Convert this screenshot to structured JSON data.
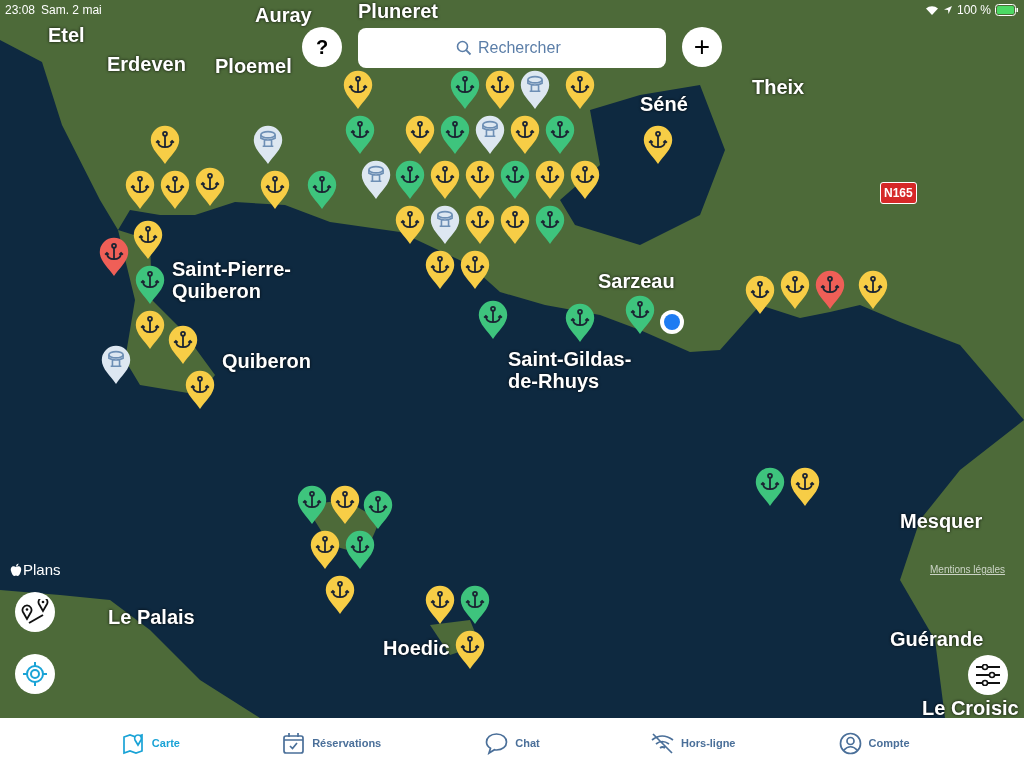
{
  "status_bar": {
    "time": "23:08",
    "date": "Sam. 2 mai",
    "battery": "100 %"
  },
  "top_bar": {
    "help_button": "?",
    "search": {
      "placeholder": "Rechercher"
    },
    "add_button": "+"
  },
  "map": {
    "labels": [
      "Pluneret",
      "Auray",
      "Etel",
      "Erdeven",
      "Ploemel",
      "Theix",
      "Séné",
      "Sarzeau",
      "Saint-Gildas-de-Rhuys",
      "Saint-Pierre-Quiberon",
      "Quiberon",
      "Le Palais",
      "Hoedic",
      "Mesquer",
      "Guérande",
      "Le Croisic"
    ],
    "road_sign": "N165",
    "pins": [
      {
        "kind": "buoy",
        "color": "#dde7f1"
      },
      {
        "kind": "buoy",
        "color": "#dde7f1"
      },
      {
        "kind": "buoy",
        "color": "#dde7f1"
      },
      {
        "kind": "buoy",
        "color": "#dde7f1"
      },
      {
        "kind": "buoy",
        "color": "#dde7f1"
      },
      {
        "kind": "buoy",
        "color": "#dde7f1"
      },
      {
        "kind": "anchor",
        "color": "#3ec47d"
      },
      {
        "kind": "anchor",
        "color": "#3ec47d"
      },
      {
        "kind": "anchor",
        "color": "#3ec47d"
      },
      {
        "kind": "anchor",
        "color": "#3ec47d"
      },
      {
        "kind": "anchor",
        "color": "#3ec47d"
      },
      {
        "kind": "anchor",
        "color": "#3ec47d"
      },
      {
        "kind": "anchor",
        "color": "#3ec47d"
      },
      {
        "kind": "anchor",
        "color": "#3ec47d"
      },
      {
        "kind": "anchor",
        "color": "#3ec47d"
      },
      {
        "kind": "anchor",
        "color": "#3ec47d"
      },
      {
        "kind": "anchor",
        "color": "#3ec47d"
      },
      {
        "kind": "anchor",
        "color": "#3ec47d"
      },
      {
        "kind": "anchor",
        "color": "#3ec47d"
      },
      {
        "kind": "anchor",
        "color": "#3ec47d"
      },
      {
        "kind": "anchor",
        "color": "#3ec47d"
      },
      {
        "kind": "anchor",
        "color": "#3ec47d"
      },
      {
        "kind": "anchor",
        "color": "#3ec47d"
      },
      {
        "kind": "anchor",
        "color": "#f7cd46"
      },
      {
        "kind": "anchor",
        "color": "#f7cd46"
      },
      {
        "kind": "anchor",
        "color": "#f7cd46"
      },
      {
        "kind": "anchor",
        "color": "#f7cd46"
      },
      {
        "kind": "anchor",
        "color": "#f7cd46"
      },
      {
        "kind": "anchor",
        "color": "#f7cd46"
      },
      {
        "kind": "anchor",
        "color": "#f7cd46"
      },
      {
        "kind": "anchor",
        "color": "#f7cd46"
      },
      {
        "kind": "anchor",
        "color": "#f7cd46"
      },
      {
        "kind": "anchor",
        "color": "#f7cd46"
      },
      {
        "kind": "anchor",
        "color": "#f7cd46"
      },
      {
        "kind": "anchor",
        "color": "#f7cd46"
      },
      {
        "kind": "anchor",
        "color": "#f7cd46"
      },
      {
        "kind": "anchor",
        "color": "#f7cd46"
      },
      {
        "kind": "anchor",
        "color": "#f7cd46"
      },
      {
        "kind": "anchor",
        "color": "#f7cd46"
      },
      {
        "kind": "anchor",
        "color": "#f7cd46"
      },
      {
        "kind": "anchor",
        "color": "#f7cd46"
      },
      {
        "kind": "anchor",
        "color": "#f7cd46"
      },
      {
        "kind": "anchor",
        "color": "#f7cd46"
      },
      {
        "kind": "anchor",
        "color": "#f7cd46"
      },
      {
        "kind": "anchor",
        "color": "#f7cd46"
      },
      {
        "kind": "anchor",
        "color": "#f7cd46"
      },
      {
        "kind": "anchor",
        "color": "#f7cd46"
      },
      {
        "kind": "anchor",
        "color": "#f7cd46"
      },
      {
        "kind": "anchor",
        "color": "#f7cd46"
      },
      {
        "kind": "anchor",
        "color": "#f7cd46"
      },
      {
        "kind": "anchor",
        "color": "#f7cd46"
      },
      {
        "kind": "anchor",
        "color": "#f7cd46"
      },
      {
        "kind": "anchor",
        "color": "#f7cd46"
      },
      {
        "kind": "anchor",
        "color": "#f7cd46"
      },
      {
        "kind": "anchor",
        "color": "#f7cd46"
      },
      {
        "kind": "anchor",
        "color": "#f7cd46"
      },
      {
        "kind": "anchor",
        "color": "#ef5f57"
      },
      {
        "kind": "anchor",
        "color": "#ef5f57"
      }
    ],
    "attribution": "Plans",
    "legal_link": "Mentions légales"
  },
  "tab_bar": [
    {
      "label": "Carte",
      "selected": true
    },
    {
      "label": "Réservations",
      "selected": false
    },
    {
      "label": "Chat",
      "selected": false
    },
    {
      "label": "Hors-ligne",
      "selected": false
    },
    {
      "label": "Compte",
      "selected": false
    }
  ]
}
